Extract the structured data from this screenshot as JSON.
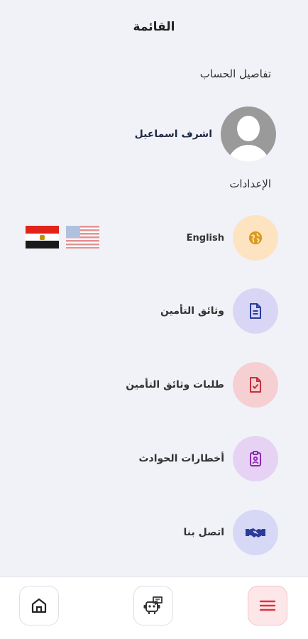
{
  "header": {
    "title": "القائمة"
  },
  "account": {
    "section_label": "تفاصيل الحساب",
    "user_name": "اشرف اسماعيل"
  },
  "settings": {
    "section_label": "الإعدادات"
  },
  "language": {
    "label": "English"
  },
  "menu": {
    "policies_label": "وثائق التأمين",
    "policy_requests_label": "طلبات وثائق التأمين",
    "accident_reports_label": "أخطارات الحوادث",
    "contact_label": "اتصل بنا"
  },
  "colors": {
    "language_circle": "#fde3bf",
    "policies_circle": "#d9d6f5",
    "requests_circle": "#f5cfd2",
    "accidents_circle": "#e6d2f3",
    "contact_circle": "#d6d8f5",
    "active_nav": "#e0323f"
  },
  "icons": {
    "language": "globe-icon",
    "policies": "document-icon",
    "requests": "document-check-icon",
    "accidents": "clipboard-person-icon",
    "contact": "handshake-icon",
    "home": "home-icon",
    "chatbot": "chatbot-icon",
    "menu": "hamburger-menu-icon"
  }
}
